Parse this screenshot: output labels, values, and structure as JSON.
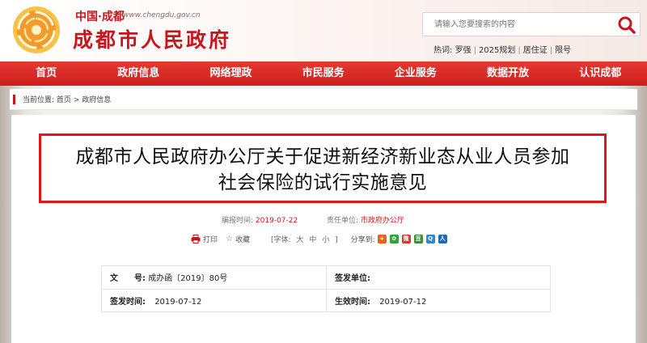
{
  "brand": {
    "small_title": "中国·成都",
    "domain": "www.chengdu.gov.cn",
    "big_title": "成都市人民政府"
  },
  "search": {
    "placeholder": "请输入您要搜索的内容"
  },
  "hot": {
    "label": "热词:",
    "items": [
      "罗强",
      "2025规划",
      "居住证",
      "限号"
    ]
  },
  "nav": {
    "items": [
      "首页",
      "政府信息",
      "网络理政",
      "市民服务",
      "企业服务",
      "数据开放",
      "认识成都"
    ]
  },
  "breadcrumb": {
    "label": "当前位置:",
    "items": [
      "首页",
      "政府信息"
    ],
    "separator": ">"
  },
  "article": {
    "title_line1": "成都市人民政府办公厅关于促进新经济新业态从业人员参加",
    "title_line2": "社会保险的试行实施意见",
    "publish_label": "编报时间:",
    "publish_date": "2019-07-22",
    "unit_label": "责任单位:",
    "unit_value": "市政府办公厅",
    "print_label": "打印",
    "favorite_label": "收藏",
    "font_label": "[字体:",
    "font_sizes": [
      "大",
      "中",
      "小"
    ],
    "font_close": "]",
    "share_label": "分享到:",
    "share_icons": [
      {
        "name": "share-plus-icon",
        "glyph": "+",
        "color": "#e8621d"
      },
      {
        "name": "share-wechat-icon",
        "glyph": "✿",
        "color": "#2fa43c"
      },
      {
        "name": "share-weibo-icon",
        "glyph": "微",
        "color": "#d33a2f"
      },
      {
        "name": "share-douban-icon",
        "glyph": "豆",
        "color": "#3d8f3f"
      },
      {
        "name": "share-qzone-icon",
        "glyph": "Q",
        "color": "#2a8ad6"
      },
      {
        "name": "share-renren-icon",
        "glyph": "人",
        "color": "#2068b8"
      }
    ]
  },
  "info": {
    "doc_no_label": "文　　号:",
    "doc_no_value": "成办函〔2019〕80号",
    "issuer_label": "签发单位:",
    "issuer_value": "",
    "issue_date_label": "签发时间:",
    "issue_date_value": "2019-07-12",
    "effective_label": "生效时间:",
    "effective_value": "2019-07-12"
  }
}
